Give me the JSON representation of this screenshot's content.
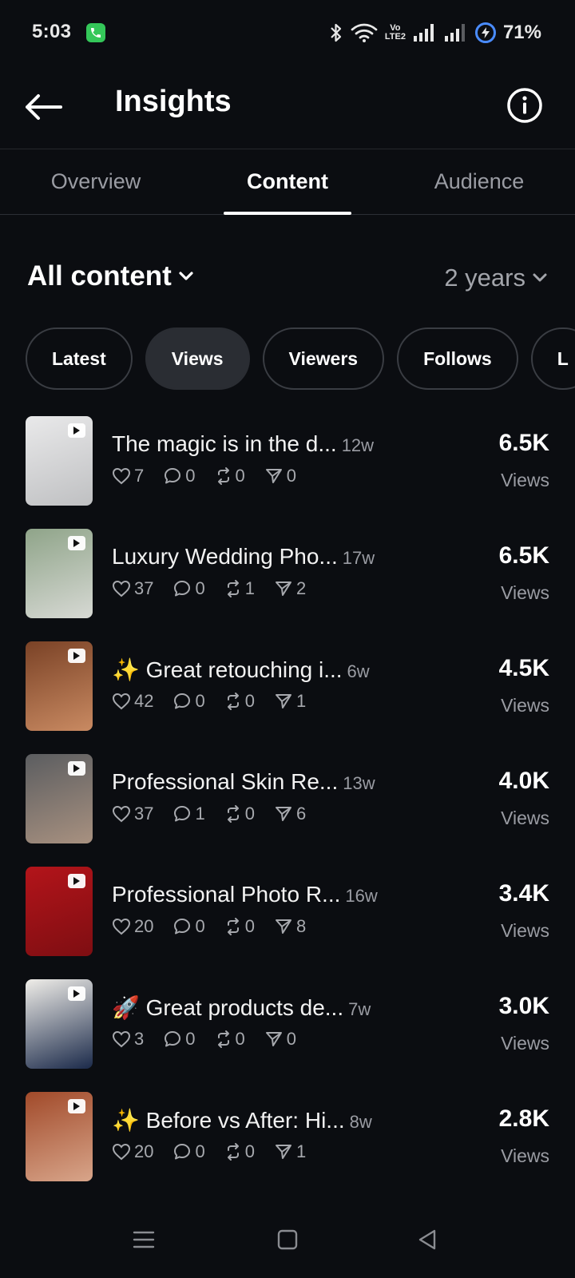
{
  "status_bar": {
    "time": "5:03",
    "network_label_top": "Vo",
    "network_label_bottom": "LTE2",
    "battery": "71%"
  },
  "header": {
    "title": "Insights"
  },
  "tabs": [
    {
      "label": "Overview",
      "active": false
    },
    {
      "label": "Content",
      "active": true
    },
    {
      "label": "Audience",
      "active": false
    }
  ],
  "filters": {
    "content_label": "All content",
    "period_label": "2 years"
  },
  "chips": [
    {
      "label": "Latest",
      "active": false
    },
    {
      "label": "Views",
      "active": true
    },
    {
      "label": "Viewers",
      "active": false
    },
    {
      "label": "Follows",
      "active": false
    },
    {
      "label": "L",
      "active": false
    }
  ],
  "posts": [
    {
      "title": "The magic is in the d...",
      "age": "12w",
      "likes": "7",
      "comments": "0",
      "reposts": "0",
      "shares": "0",
      "value": "6.5K",
      "unit": "Views",
      "thumb_colors": [
        "#e9e9ea",
        "#bfc0c2"
      ]
    },
    {
      "title": "Luxury Wedding Pho...",
      "age": "17w",
      "likes": "37",
      "comments": "0",
      "reposts": "1",
      "shares": "2",
      "value": "6.5K",
      "unit": "Views",
      "thumb_colors": [
        "#8fa489",
        "#d7d9d4"
      ]
    },
    {
      "title": "✨ Great retouching i...",
      "age": "6w",
      "likes": "42",
      "comments": "0",
      "reposts": "0",
      "shares": "1",
      "value": "4.5K",
      "unit": "Views",
      "thumb_colors": [
        "#7a4226",
        "#c98a62"
      ]
    },
    {
      "title": "Professional Skin Re...",
      "age": "13w",
      "likes": "37",
      "comments": "1",
      "reposts": "0",
      "shares": "6",
      "value": "4.0K",
      "unit": "Views",
      "thumb_colors": [
        "#5b5d60",
        "#a89180"
      ]
    },
    {
      "title": "Professional Photo R...",
      "age": "16w",
      "likes": "20",
      "comments": "0",
      "reposts": "0",
      "shares": "8",
      "value": "3.4K",
      "unit": "Views",
      "thumb_colors": [
        "#b3141a",
        "#7e0e12"
      ]
    },
    {
      "title": "🚀 Great products de...",
      "age": "7w",
      "likes": "3",
      "comments": "0",
      "reposts": "0",
      "shares": "0",
      "value": "3.0K",
      "unit": "Views",
      "thumb_colors": [
        "#f0eee9",
        "#1b2a4a"
      ]
    },
    {
      "title": "✨ Before vs After: Hi...",
      "age": "8w",
      "likes": "20",
      "comments": "0",
      "reposts": "0",
      "shares": "1",
      "value": "2.8K",
      "unit": "Views",
      "thumb_colors": [
        "#a14a2a",
        "#d8a58a"
      ]
    }
  ]
}
